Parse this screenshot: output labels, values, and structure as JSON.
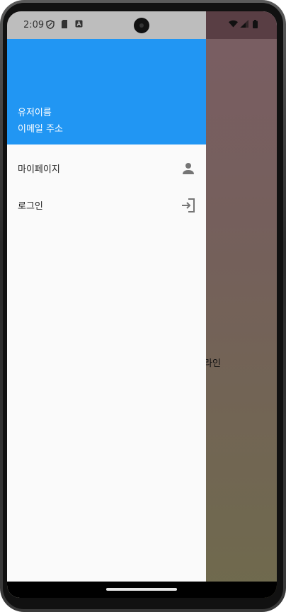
{
  "status_bar": {
    "time": "2:09",
    "icons_left": [
      "shield-icon",
      "sd-card-icon",
      "a-badge-icon"
    ],
    "icons_right": [
      "wifi-icon",
      "signal-icon",
      "battery-icon"
    ]
  },
  "drawer": {
    "header": {
      "username": "유저이름",
      "email": "이메일 주소",
      "background": "#2196f3"
    },
    "items": [
      {
        "label": "마이페이지",
        "icon": "person-icon"
      },
      {
        "label": "로그인",
        "icon": "login-icon"
      }
    ]
  },
  "background_page": {
    "partial_text": "라인"
  }
}
